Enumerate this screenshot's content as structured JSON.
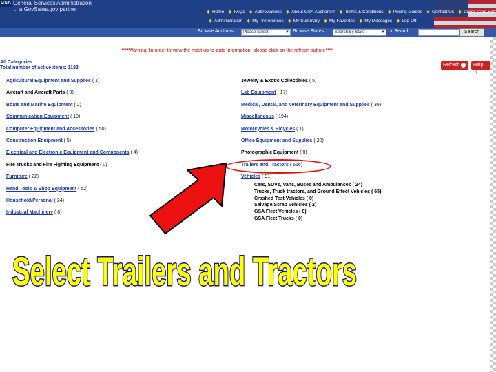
{
  "header": {
    "logo": "GSA",
    "tagline_1": "General Services Administration",
    "tagline_2": "... a GovSales.gov partner",
    "nav_top": [
      "Home",
      "FAQs",
      "Abbreviations",
      "About GSA Auctions®",
      "Terms & Conditions",
      "Pricing Guides",
      "Contact Us",
      "Credit Card Form"
    ],
    "nav_bottom": [
      "Administration",
      "My Preferences",
      "My Summary",
      "My Favorites",
      "My Messages",
      "Log Off"
    ]
  },
  "search": {
    "browse_auctions_label": "Browse Auctions:",
    "browse_auctions_value": "Please Select",
    "browse_states_label": "Browse States:",
    "browse_states_value": "Search By State",
    "or_search_label": "or Search:",
    "search_button": "Search"
  },
  "warning": "****Warning: In order to view the most up-to-date information, please click on the refresh button.****",
  "all_categories": "All Categories",
  "total_items": "Total number of active items: 1183",
  "refresh_label": "Refresh",
  "help_label": "Help",
  "categories_left": [
    {
      "name": "Agricultural Equipment and Supplies",
      "count": "( 1)",
      "link": true
    },
    {
      "name": "Aircraft and Aircraft Parts",
      "count": "( 0)",
      "link": false
    },
    {
      "name": "Boats and Marine Equipment",
      "count": "( 2)",
      "link": true
    },
    {
      "name": "Communication Equipment",
      "count": "( 19)",
      "link": true
    },
    {
      "name": "Computer Equipment and Accessories",
      "count": "( 50)",
      "link": true
    },
    {
      "name": "Construction Equipment",
      "count": "( 5)",
      "link": true
    },
    {
      "name": "Electrical and Electronic Equipment and Components",
      "count": "( 4)",
      "link": true
    },
    {
      "name": "Fire Trucks and Fire Fighting Equipment",
      "count": "( 0)",
      "link": false
    },
    {
      "name": "Furniture",
      "count": "( 22)",
      "link": true
    },
    {
      "name": "Hand Tools & Shop Equipment",
      "count": "( 52)",
      "link": true
    },
    {
      "name": "Household/Personal",
      "count": "( 24)",
      "link": true
    },
    {
      "name": "Industrial Machinery",
      "count": "( 8)",
      "link": true
    }
  ],
  "categories_right": [
    {
      "name": "Jewelry & Exotic Collectibles",
      "count": "( 5)",
      "link": false
    },
    {
      "name": "Lab Equipment",
      "count": "( 17)",
      "link": true
    },
    {
      "name": "Medical, Dental, and Veterinary Equipment and Supplies",
      "count": "( 36)",
      "link": true
    },
    {
      "name": "Miscellaneous",
      "count": "( 194)",
      "link": true
    },
    {
      "name": "Motorcycles & Bicycles",
      "count": "( 1)",
      "link": true
    },
    {
      "name": "Office Equipment and Supplies",
      "count": "( 20)",
      "link": true
    },
    {
      "name": "Photographic Equipment",
      "count": "( 0)",
      "link": false
    },
    {
      "name": "Trailers and Tractors",
      "count": "( 616)",
      "link": true
    },
    {
      "name": "Vehicles",
      "count": "( 91)",
      "link": true
    }
  ],
  "vehicle_subcategories": [
    {
      "name": "Cars, SUVs, Vans, Buses and Ambulances",
      "count": "( 24)"
    },
    {
      "name": "Trucks, Truck tractors, and Ground Effect Vehicles",
      "count": "( 65)"
    },
    {
      "name": "Crashed Test Vehicles",
      "count": "( 0)"
    },
    {
      "name": "Salvage/Scrap Vehicles",
      "count": "( 2)"
    },
    {
      "name": "GSA Fleet Vehicles",
      "count": "( 0)"
    },
    {
      "name": "GSA Fleet Trucks",
      "count": "( 0)"
    }
  ],
  "caption": "Select Trailers and Tractors",
  "colors": {
    "header_bg": "#1f3f86",
    "link": "#1c3aa6",
    "highlight": "#e01010",
    "caption_fill": "#ffff00",
    "caption_stroke": "#1a1a6e"
  }
}
